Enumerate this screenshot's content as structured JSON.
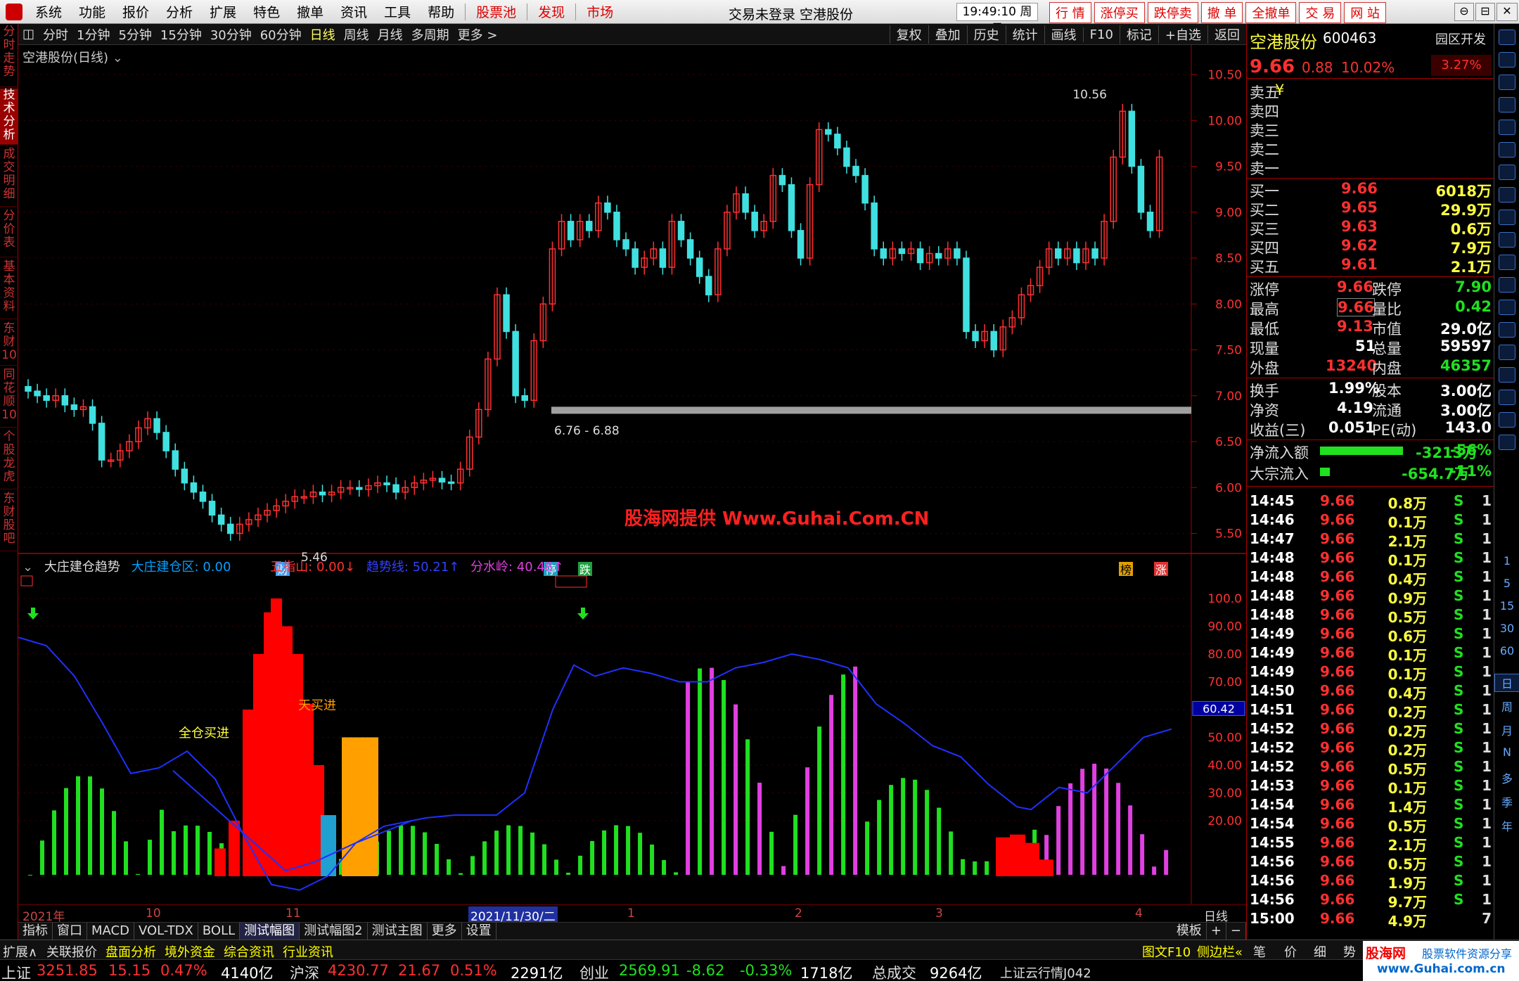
{
  "app": {
    "menu": [
      "系统",
      "功能",
      "报价",
      "分析",
      "扩展",
      "特色",
      "撤单",
      "资讯",
      "工具",
      "帮助"
    ],
    "menu_red": [
      "股票池",
      "发现",
      "市场"
    ],
    "title": "交易未登录  空港股份",
    "clock": "19:49:10 周日",
    "right_buttons": [
      "行 情",
      "涨停买",
      "跌停卖",
      "撤 单",
      "全撤单",
      "交 易",
      "网 站"
    ],
    "win_buttons": [
      "⊖",
      "⊟",
      "✕"
    ]
  },
  "left_tabs": [
    "分时走势",
    "技术分析",
    "成交明细",
    "分价表",
    "基本资料",
    "东财10",
    "同花顺10",
    "个股龙虎",
    "东财股吧"
  ],
  "toolbar": {
    "periods": [
      "分时",
      "1分钟",
      "5分钟",
      "15分钟",
      "30分钟",
      "60分钟",
      "日线",
      "周线",
      "月线",
      "多周期",
      "更多 >"
    ],
    "active": "日线",
    "right": [
      "复权",
      "叠加",
      "历史",
      "统计",
      "画线",
      "F10",
      "标记",
      "+自选",
      "返回"
    ]
  },
  "price_chart": {
    "title": "空港股份(日线)",
    "high_label": "10.56",
    "low_label": "5.46",
    "band_label": "6.76 - 6.88",
    "markers": [
      "财",
      "停",
      "跌",
      "榜",
      "涨"
    ],
    "y_axis": [
      "10.50",
      "10.00",
      "9.50",
      "9.00",
      "8.50",
      "8.00",
      "7.50",
      "7.00",
      "6.50",
      "6.00",
      "5.50"
    ]
  },
  "indicator": {
    "name": "大庄建仓趋势",
    "items": [
      {
        "label": "大庄建仓区: 0.00",
        "color": "#00a0ff"
      },
      {
        "label": "五指山: 0.00↓",
        "color": "#ff3030"
      },
      {
        "label": "趋势线: 50.21↑",
        "color": "#3040ff"
      },
      {
        "label": "分水岭: 40.48↑",
        "color": "#e040e0"
      }
    ],
    "labels": {
      "full_buy": "全仓买进",
      "buy": "天买进"
    },
    "current": "60.42",
    "y_axis": [
      "100.0",
      "90.00",
      "80.00",
      "70.00",
      "60.00",
      "50.00",
      "40.00",
      "30.00",
      "20.00"
    ]
  },
  "x_axis": {
    "labels": [
      "2021年",
      "10",
      "11",
      "2021/11/30/二",
      "1",
      "2",
      "3",
      "4"
    ],
    "right": "日线"
  },
  "bottom_tabs": [
    "指标",
    "窗口",
    "MACD",
    "VOL-TDX",
    "BOLL",
    "测试幅图",
    "测试幅图2",
    "测试主图",
    "更多",
    "设置"
  ],
  "bottom_right": [
    "模板",
    "+",
    "−"
  ],
  "watermark": "股海网提供 Www.Guhai.Com.CN",
  "quote": {
    "name": "空港股份",
    "code": "600463",
    "region": "园区开发",
    "price": "9.66",
    "change": "0.88",
    "pct": "10.02%",
    "side_pct": "3.27%",
    "sell": [
      {
        "label": "卖五",
        "price": "",
        "vol": "¥"
      },
      {
        "label": "卖四",
        "price": "",
        "vol": ""
      },
      {
        "label": "卖三",
        "price": "",
        "vol": ""
      },
      {
        "label": "卖二",
        "price": "",
        "vol": ""
      },
      {
        "label": "卖一",
        "price": "",
        "vol": ""
      }
    ],
    "buy": [
      {
        "label": "买一",
        "price": "9.66",
        "vol": "6018万"
      },
      {
        "label": "买二",
        "price": "9.65",
        "vol": "29.9万"
      },
      {
        "label": "买三",
        "price": "9.63",
        "vol": "0.6万"
      },
      {
        "label": "买四",
        "price": "9.62",
        "vol": "7.9万"
      },
      {
        "label": "买五",
        "price": "9.61",
        "vol": "2.1万"
      }
    ],
    "stats": [
      [
        "涨停",
        "9.66",
        "跌停",
        "7.90"
      ],
      [
        "最高",
        "9.66",
        "量比",
        "0.42"
      ],
      [
        "最低",
        "9.13",
        "市值",
        "29.0亿"
      ],
      [
        "现量",
        "51",
        "总量",
        "59597"
      ],
      [
        "外盘",
        "13240",
        "内盘",
        "46357"
      ]
    ],
    "stats2": [
      [
        "换手",
        "1.99%",
        "股本",
        "3.00亿"
      ],
      [
        "净资",
        "4.19",
        "流通",
        "3.00亿"
      ],
      [
        "收益(三)",
        "0.051",
        "PE(动)",
        "143.0"
      ]
    ],
    "flow": [
      {
        "label": "净流入额",
        "value": "-3213万",
        "pct": "-56%"
      },
      {
        "label": "大宗流入",
        "value": "-654.7万",
        "pct": "-11%"
      }
    ]
  },
  "ticks": [
    [
      "14:45",
      "9.66",
      "0.8万",
      "S",
      "1"
    ],
    [
      "14:46",
      "9.66",
      "0.1万",
      "S",
      "1"
    ],
    [
      "14:47",
      "9.66",
      "2.1万",
      "S",
      "1"
    ],
    [
      "14:48",
      "9.66",
      "0.1万",
      "S",
      "1"
    ],
    [
      "14:48",
      "9.66",
      "0.4万",
      "S",
      "1"
    ],
    [
      "14:48",
      "9.66",
      "0.9万",
      "S",
      "1"
    ],
    [
      "14:48",
      "9.66",
      "0.5万",
      "S",
      "1"
    ],
    [
      "14:49",
      "9.66",
      "0.6万",
      "S",
      "1"
    ],
    [
      "14:49",
      "9.66",
      "0.1万",
      "S",
      "1"
    ],
    [
      "14:49",
      "9.66",
      "0.1万",
      "S",
      "1"
    ],
    [
      "14:50",
      "9.66",
      "0.4万",
      "S",
      "1"
    ],
    [
      "14:51",
      "9.66",
      "0.2万",
      "S",
      "1"
    ],
    [
      "14:52",
      "9.66",
      "0.2万",
      "S",
      "1"
    ],
    [
      "14:52",
      "9.66",
      "0.2万",
      "S",
      "1"
    ],
    [
      "14:52",
      "9.66",
      "0.5万",
      "S",
      "1"
    ],
    [
      "14:53",
      "9.66",
      "0.1万",
      "S",
      "1"
    ],
    [
      "14:54",
      "9.66",
      "1.4万",
      "S",
      "1"
    ],
    [
      "14:54",
      "9.66",
      "0.5万",
      "S",
      "1"
    ],
    [
      "14:55",
      "9.66",
      "2.1万",
      "S",
      "1"
    ],
    [
      "14:56",
      "9.66",
      "0.5万",
      "S",
      "1"
    ],
    [
      "14:56",
      "9.66",
      "1.9万",
      "S",
      "1"
    ],
    [
      "14:56",
      "9.66",
      "9.7万",
      "S",
      "1"
    ],
    [
      "15:00",
      "9.66",
      "4.9万",
      "",
      "7"
    ]
  ],
  "rstrip_labels": [
    "1",
    "5",
    "15",
    "30",
    "60",
    "日",
    "周",
    "月",
    "N",
    "多",
    "季",
    "年"
  ],
  "status": {
    "left": [
      "扩展∧",
      "关联报价",
      "盘面分析",
      "境外资金",
      "综合资讯",
      "行业资讯"
    ],
    "right": [
      "图文F10",
      "侧边栏«"
    ],
    "tabs": [
      "笔",
      "价",
      "细",
      "势"
    ]
  },
  "index_bar": [
    {
      "name": "上证",
      "value": "3251.85",
      "chg": "15.15",
      "pct": "0.47%",
      "amt": "4140亿"
    },
    {
      "name": "沪深",
      "value": "4230.77",
      "chg": "21.67",
      "pct": "0.51%",
      "amt": "2291亿"
    },
    {
      "name": "创业",
      "value": "2569.91",
      "chg": "-8.62",
      "pct": "-0.33%",
      "amt": "1718亿"
    }
  ],
  "total": {
    "label": "总成交",
    "value": "9264亿"
  },
  "cloud": "上证云行情J042",
  "logo": {
    "name": "股海网",
    "tag": "股票软件资源分享",
    "url": "www.Guhai.com.cn"
  },
  "colors": {
    "up": "#ff3030",
    "down": "#40e0e0",
    "green": "#20e020",
    "accent": "#ffff00",
    "panel_border": "#aa0000"
  }
}
